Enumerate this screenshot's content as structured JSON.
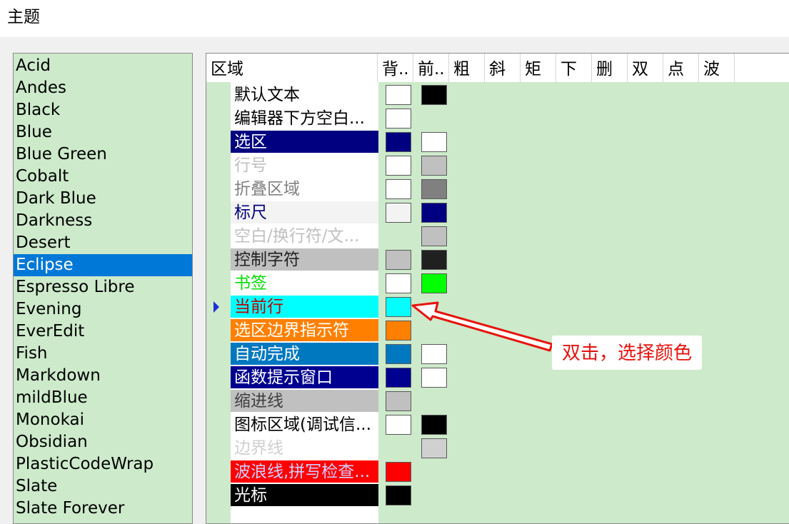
{
  "dialog": {
    "section_title": "主题"
  },
  "themes": {
    "items": [
      "Acid",
      "Andes",
      "Black",
      "Blue",
      "Blue Green",
      "Cobalt",
      "Dark Blue",
      "Darkness",
      "Desert",
      "Eclipse",
      "Espresso Libre",
      "Evening",
      "EverEdit",
      "Fish",
      "Markdown",
      "mildBlue",
      "Monokai",
      "Obsidian",
      "PlasticCodeWrap",
      "Slate",
      "Slate Forever"
    ],
    "selected": "Eclipse"
  },
  "grid": {
    "headers": [
      "区域",
      "背..",
      "前..",
      "粗",
      "斜",
      "矩",
      "下",
      "删",
      "双",
      "点",
      "波"
    ],
    "rows": [
      {
        "label": "默认文本",
        "label_bg": "#ffffff",
        "label_fg": "#000000",
        "bg": "#ffffff",
        "fg": "#000000"
      },
      {
        "label": "编辑器下方空白...",
        "label_bg": "#ffffff",
        "label_fg": "#000000",
        "bg": "#ffffff",
        "fg": null
      },
      {
        "label": "选区",
        "label_bg": "#000080",
        "label_fg": "#ffffff",
        "bg": "#000080",
        "fg": "#ffffff"
      },
      {
        "label": "行号",
        "label_bg": "#ffffff",
        "label_fg": "#c0c0c0",
        "bg": "#ffffff",
        "fg": "#c0c0c0"
      },
      {
        "label": "折叠区域",
        "label_bg": "#ffffff",
        "label_fg": "#808080",
        "bg": "#ffffff",
        "fg": "#808080"
      },
      {
        "label": "标尺",
        "label_bg": "#f3f3f3",
        "label_fg": "#000080",
        "bg": "#f3f3f3",
        "fg": "#000080"
      },
      {
        "label": "空白/换行符/文...",
        "label_bg": "#ffffff",
        "label_fg": "#c0c0c0",
        "bg": null,
        "fg": "#c0c0c0"
      },
      {
        "label": "控制字符",
        "label_bg": "#c0c0c0",
        "label_fg": "#202020",
        "bg": "#c0c0c0",
        "fg": "#202020"
      },
      {
        "label": "书签",
        "label_bg": "#ffffff",
        "label_fg": "#00e000",
        "bg": "#ffffff",
        "fg": "#00ff00"
      },
      {
        "label": "当前行",
        "label_bg": "#00ffff",
        "label_fg": "#c00000",
        "bg": "#00ffff",
        "fg": null
      },
      {
        "label": "选区边界指示符",
        "label_bg": "#ff8000",
        "label_fg": "#ffffff",
        "bg": "#ff8000",
        "fg": null
      },
      {
        "label": "自动完成",
        "label_bg": "#0078c0",
        "label_fg": "#ffffff",
        "bg": "#0078c0",
        "fg": "#ffffff"
      },
      {
        "label": "函数提示窗口",
        "label_bg": "#000090",
        "label_fg": "#ffffff",
        "bg": "#000090",
        "fg": "#ffffff"
      },
      {
        "label": "缩进线",
        "label_bg": "#c0c0c0",
        "label_fg": "#404040",
        "bg": "#c0c0c0",
        "fg": null
      },
      {
        "label": "图标区域(调试信...",
        "label_bg": "#ffffff",
        "label_fg": "#000000",
        "bg": "#ffffff",
        "fg": "#000000"
      },
      {
        "label": "边界线",
        "label_bg": "#ffffff",
        "label_fg": "#d0d0d0",
        "bg": null,
        "fg": "#d0d0d0"
      },
      {
        "label": "波浪线,拼写检查...",
        "label_bg": "#ff0000",
        "label_fg": "#d0d0ff",
        "bg": "#ff0000",
        "fg": null
      },
      {
        "label": "光标",
        "label_bg": "#000000",
        "label_fg": "#ffffff",
        "bg": "#000000",
        "fg": null
      }
    ],
    "current_row_index": 9
  },
  "annotation": {
    "text": "双击，选择颜色",
    "color": "#e8120c"
  }
}
